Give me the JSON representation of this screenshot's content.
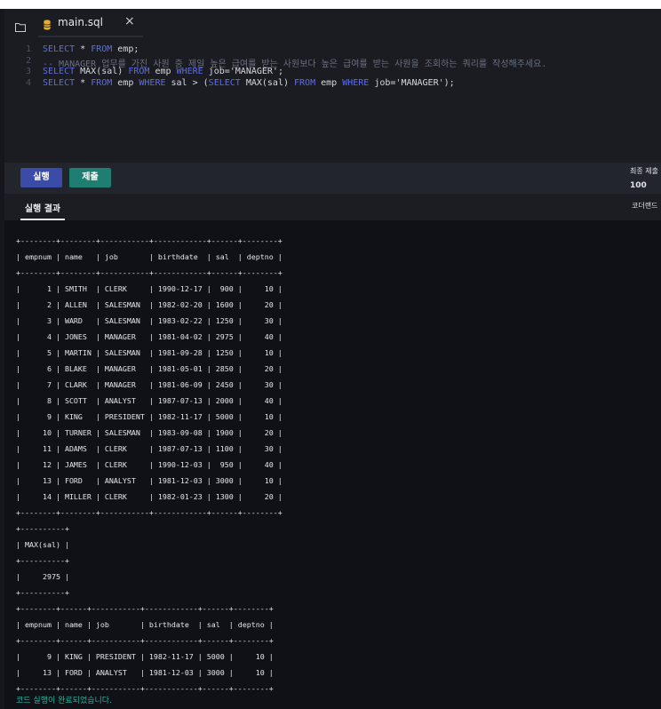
{
  "editor": {
    "tab_name": "main.sql",
    "close_glyph": "×",
    "lines": [
      {
        "num": "1",
        "tokens": [
          {
            "t": "SELECT",
            "c": "kw"
          },
          {
            "t": " * ",
            "c": "tx"
          },
          {
            "t": "FROM",
            "c": "kw"
          },
          {
            "t": " emp;",
            "c": "tx"
          }
        ]
      },
      {
        "num": "2",
        "tokens": [
          {
            "t": "-- MANAGER 업무를 가진 사원 중 제일 높은 급여를 받는 사원보다 높은 급여를 받는 사원을 조회하는 쿼리를 작성해주세요.",
            "c": "cm"
          }
        ]
      },
      {
        "num": "3",
        "tokens": [
          {
            "t": "SELECT",
            "c": "kw"
          },
          {
            "t": " MAX(sal) ",
            "c": "tx"
          },
          {
            "t": "FROM",
            "c": "kw"
          },
          {
            "t": " emp ",
            "c": "tx"
          },
          {
            "t": "WHERE",
            "c": "kw"
          },
          {
            "t": " job='MANAGER';",
            "c": "tx"
          }
        ]
      },
      {
        "num": "4",
        "tokens": [
          {
            "t": "SELECT",
            "c": "kw"
          },
          {
            "t": " * ",
            "c": "tx"
          },
          {
            "t": "FROM",
            "c": "kw"
          },
          {
            "t": " emp ",
            "c": "tx"
          },
          {
            "t": "WHERE",
            "c": "kw"
          },
          {
            "t": " sal > (",
            "c": "tx"
          },
          {
            "t": "SELECT",
            "c": "kw"
          },
          {
            "t": " MAX(sal) ",
            "c": "tx"
          },
          {
            "t": "FROM",
            "c": "kw"
          },
          {
            "t": " emp ",
            "c": "tx"
          },
          {
            "t": "WHERE",
            "c": "kw"
          },
          {
            "t": " job='MANAGER');",
            "c": "tx"
          }
        ]
      }
    ]
  },
  "toolbar": {
    "run_label": "실행",
    "submit_label": "제출",
    "last_submit_label": "최종 제출",
    "score": "100"
  },
  "result_tabs": {
    "active_label": "실행 결과",
    "right_label": "코더랜드"
  },
  "output": {
    "lines": [
      "+--------+--------+-----------+------------+------+--------+",
      "| empnum | name   | job       | birthdate  | sal  | deptno |",
      "+--------+--------+-----------+------------+------+--------+",
      "|      1 | SMITH  | CLERK     | 1990-12-17 |  900 |     10 |",
      "|      2 | ALLEN  | SALESMAN  | 1982-02-20 | 1600 |     20 |",
      "|      3 | WARD   | SALESMAN  | 1983-02-22 | 1250 |     30 |",
      "|      4 | JONES  | MANAGER   | 1981-04-02 | 2975 |     40 |",
      "|      5 | MARTIN | SALESMAN  | 1981-09-28 | 1250 |     10 |",
      "|      6 | BLAKE  | MANAGER   | 1981-05-01 | 2850 |     20 |",
      "|      7 | CLARK  | MANAGER   | 1981-06-09 | 2450 |     30 |",
      "|      8 | SCOTT  | ANALYST   | 1987-07-13 | 2000 |     40 |",
      "|      9 | KING   | PRESIDENT | 1982-11-17 | 5000 |     10 |",
      "|     10 | TURNER | SALESMAN  | 1983-09-08 | 1900 |     20 |",
      "|     11 | ADAMS  | CLERK     | 1987-07-13 | 1100 |     30 |",
      "|     12 | JAMES  | CLERK     | 1990-12-03 |  950 |     40 |",
      "|     13 | FORD   | ANALYST   | 1981-12-03 | 3000 |     10 |",
      "|     14 | MILLER | CLERK     | 1982-01-23 | 1300 |     20 |",
      "+--------+--------+-----------+------------+------+--------+",
      "+----------+",
      "| MAX(sal) |",
      "+----------+",
      "|     2975 |",
      "+----------+",
      "+--------+------+-----------+------------+------+--------+",
      "| empnum | name | job       | birthdate  | sal  | deptno |",
      "+--------+------+-----------+------------+------+--------+",
      "|      9 | KING | PRESIDENT | 1982-11-17 | 5000 |     10 |",
      "|     13 | FORD | ANALYST   | 1981-12-03 | 3000 |     10 |",
      "+--------+------+-----------+------------+------+--------+"
    ],
    "status": "코드 실행이 완료되었습니다."
  },
  "icons": {
    "file_explorer": "folder-icon",
    "tab_file": "database-icon"
  },
  "colors": {
    "keyword": "#5a6cf0",
    "run_button": "#3b4ba8",
    "submit_button": "#1f7e72",
    "status_text": "#20b8a2"
  }
}
